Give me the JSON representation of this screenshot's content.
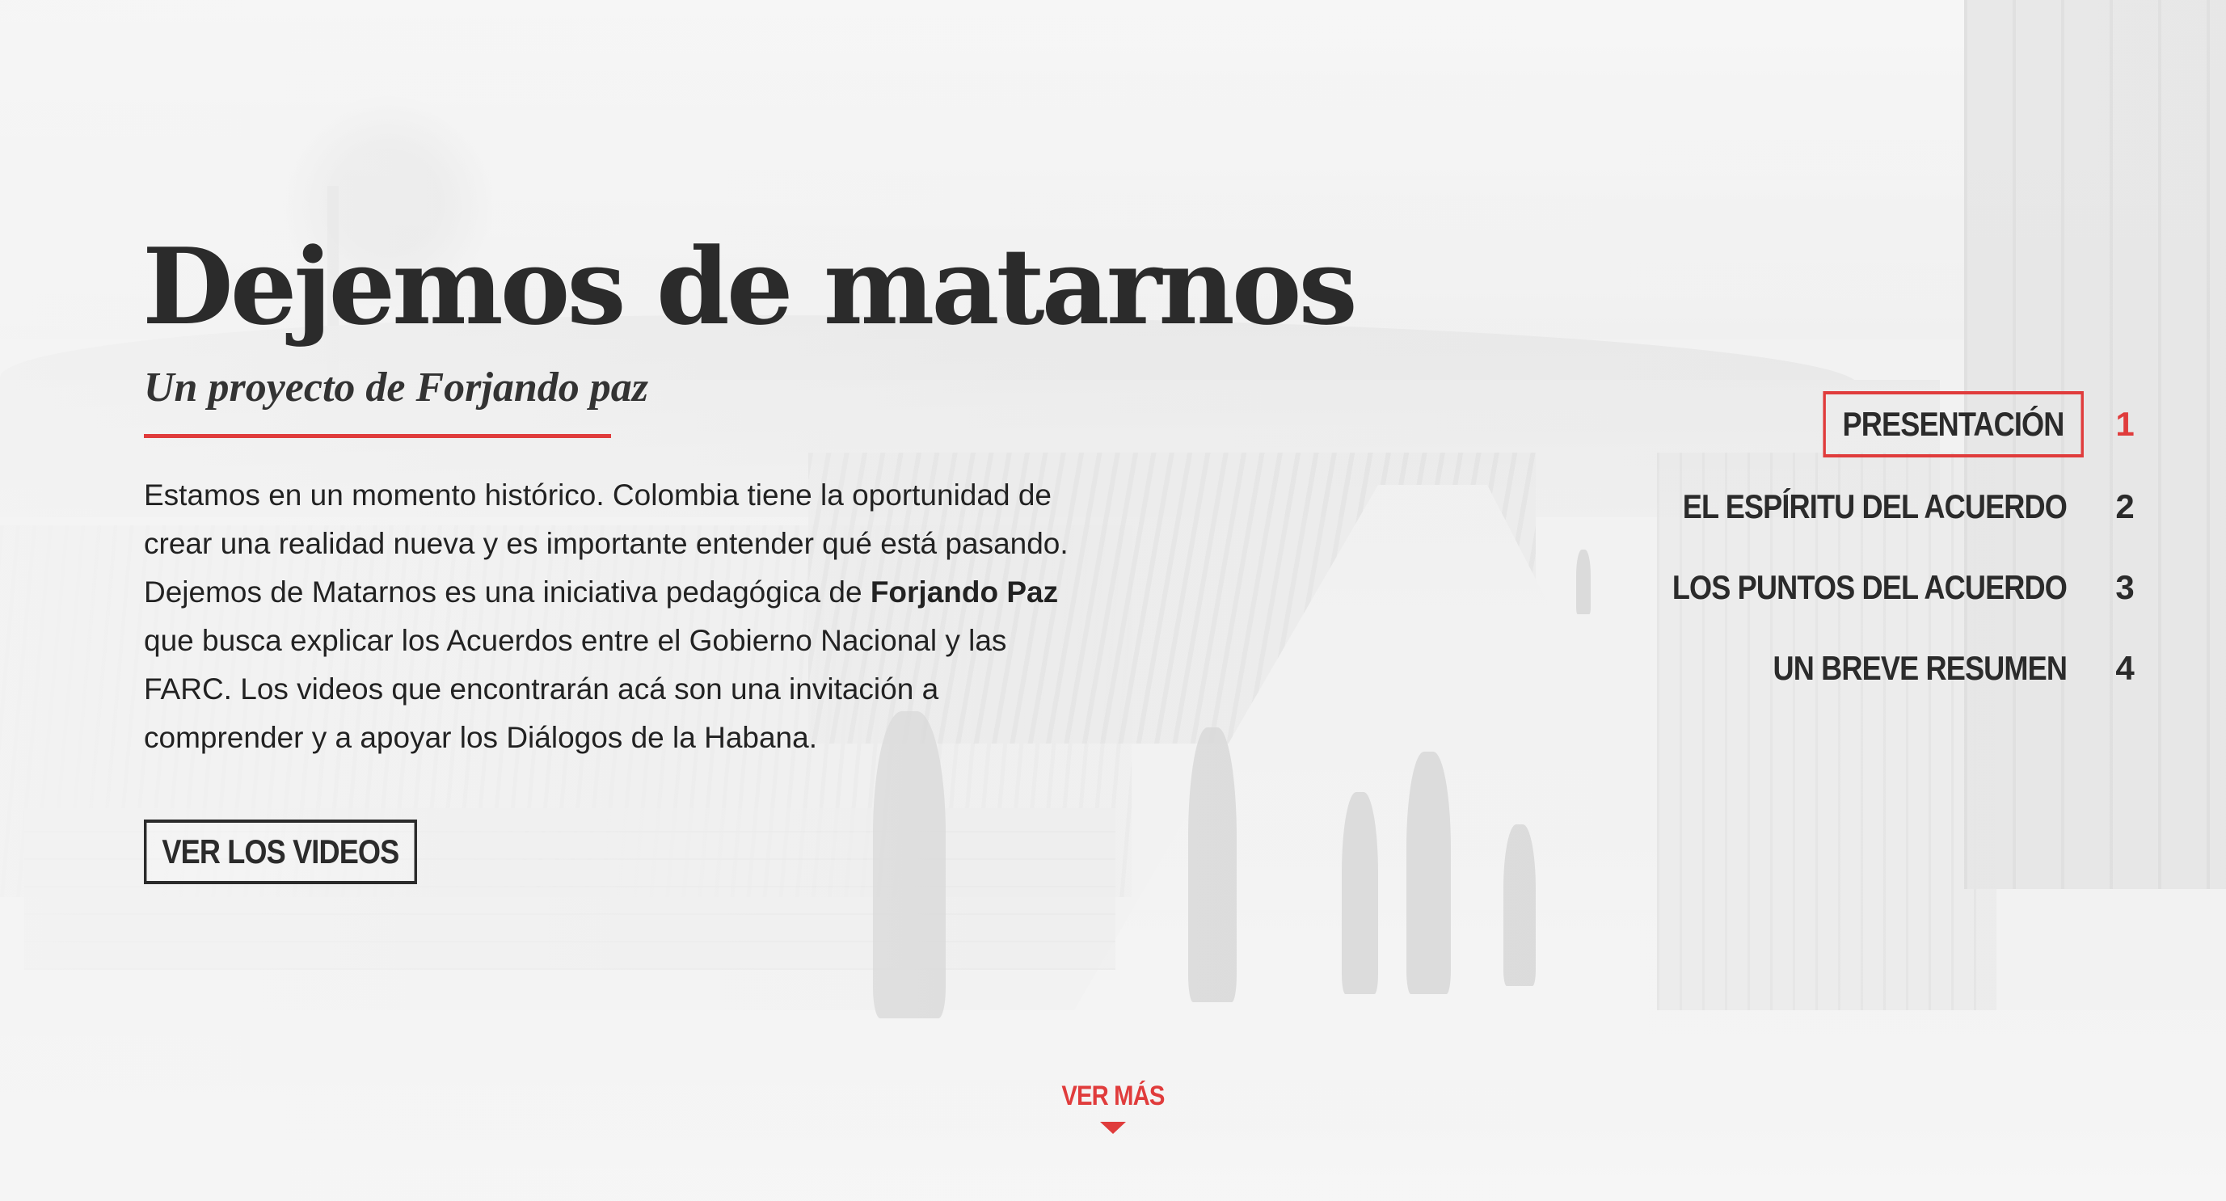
{
  "hero": {
    "title": "Dejemos de matarnos",
    "subtitle": "Un proyecto de Forjando paz",
    "intro_part1": "Estamos en un momento histórico. Colombia tiene la oportunidad de crear una realidad nueva y es importante entender qué está pasando. Dejemos de Matarnos es una iniciativa pedagógica de ",
    "intro_bold": "Forjando Paz",
    "intro_part2": " que busca explicar los Acuerdos entre el Gobierno Nacional y las FARC. Los videos que encontrarán acá son una invitación a comprender y a apoyar los Diálogos de la Habana.",
    "cta_label": "VER LOS VIDEOS"
  },
  "nav": {
    "items": [
      {
        "label": "PRESENTACIÓN",
        "number": "1",
        "active": true
      },
      {
        "label": "EL ESPÍRITU DEL ACUERDO",
        "number": "2",
        "active": false
      },
      {
        "label": "LOS PUNTOS DEL ACUERDO",
        "number": "3",
        "active": false
      },
      {
        "label": "UN BREVE RESUMEN",
        "number": "4",
        "active": false
      }
    ]
  },
  "footer": {
    "more_label": "VER MÁS",
    "more_icon": "caret-down-icon"
  },
  "colors": {
    "accent": "#e03c3c",
    "text": "#2b2b2b",
    "background": "#efefef"
  }
}
